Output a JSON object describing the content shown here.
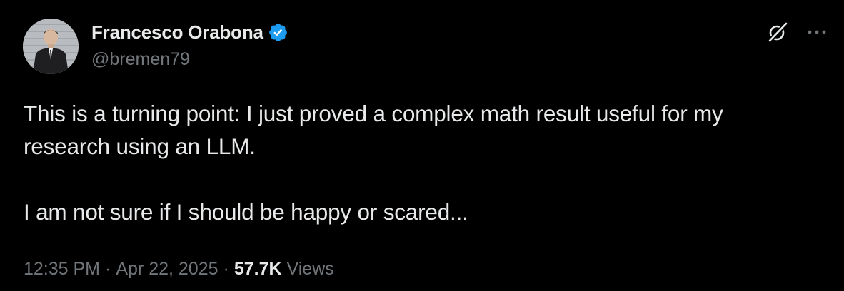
{
  "author": {
    "display_name": "Francesco Orabona",
    "handle": "@bremen79",
    "verified": true
  },
  "tweet": {
    "line1": "This is a turning point: I just proved a complex math result useful for my",
    "line2": "research using an LLM.",
    "line3": "I am not sure if I should be happy or scared..."
  },
  "meta": {
    "time": "12:35 PM",
    "separator": "·",
    "date": "Apr 22, 2025",
    "views_count": "57.7K",
    "views_label": "Views"
  },
  "icons": {
    "verified": "verified-badge-icon",
    "grok": "grok-icon",
    "more": "more-icon"
  },
  "colors": {
    "background": "#000000",
    "primary_text": "#e7e9ea",
    "secondary_text": "#71767b",
    "verified_blue": "#1d9bf0"
  }
}
